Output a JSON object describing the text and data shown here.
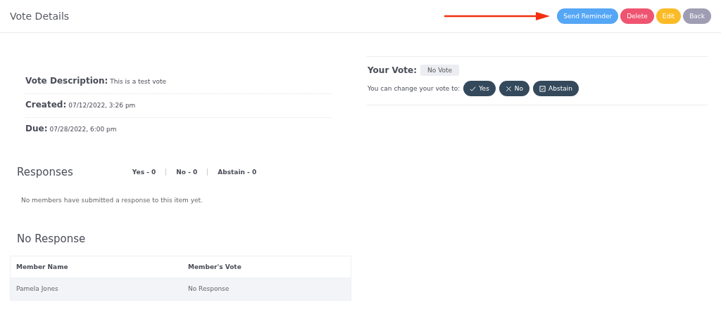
{
  "header": {
    "title": "Vote Details",
    "buttons": [
      {
        "label": "Send Reminder",
        "kind": "primary"
      },
      {
        "label": "Delete",
        "kind": "danger"
      },
      {
        "label": "Edit",
        "kind": "warning"
      },
      {
        "label": "Back",
        "kind": "secondary"
      }
    ]
  },
  "details": [
    {
      "label": "Vote Description:",
      "value": "This is a test vote"
    },
    {
      "label": "Created:",
      "value": "07/12/2022, 3:26 pm"
    },
    {
      "label": "Due:",
      "value": "07/28/2022, 6:00 pm"
    }
  ],
  "your_vote": {
    "label": "Your Vote:",
    "value": "No Vote",
    "change_label": "You can change your vote to:",
    "options": [
      {
        "label": "Yes",
        "kind": "yes"
      },
      {
        "label": "No",
        "kind": "no"
      },
      {
        "label": "Abstain",
        "kind": "abstain"
      }
    ]
  },
  "responses": {
    "title": "Responses",
    "counts": [
      "Yes - 0",
      "No - 0",
      "Abstain - 0"
    ],
    "empty_message": "No members have submitted a response to this item yet."
  },
  "no_response": {
    "title": "No Response",
    "columns": [
      "Member Name",
      "Member's Vote"
    ],
    "rows": [
      [
        "Pamela Jones",
        "No Response"
      ]
    ]
  }
}
